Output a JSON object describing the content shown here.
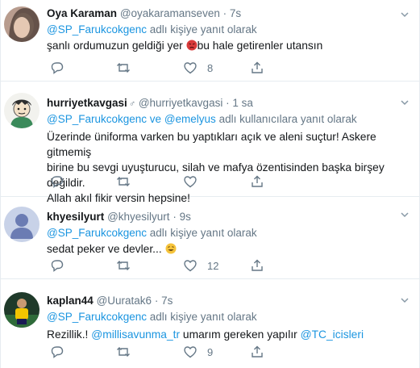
{
  "tweets": [
    {
      "name": "Oya Karaman",
      "handle": "@oyakaramanseven",
      "time": "7s",
      "reply_prefix": "",
      "reply_links": [
        "@SP_Farukcokgenc"
      ],
      "reply_suffix": "adlı kişiye yanıt olarak",
      "text_before": "şanlı ordumuzun geldiği yer",
      "text_after": "bu hale getirenler utansın",
      "reply_count": "",
      "retweet_count": "",
      "like_count": "8"
    },
    {
      "name": "hurriyetkavgasi",
      "name_badge": "♂",
      "handle": "@hurriyetkavgasi",
      "time": "1 sa",
      "reply_links": [
        "@SP_Farukcokgenc",
        "@emelyus"
      ],
      "reply_join": "ve",
      "reply_suffix": "adlı kullanıcılara yanıt olarak",
      "text_lines": [
        "Üzerinde üniforma varken bu yaptıkları açık ve aleni suçtur! Askere gitmemiş",
        "birine bu sevgi uyuşturucu, silah ve mafya özentisinden başka birşey değildir.",
        "Allah akıl fikir versin hepsine!"
      ],
      "reply_count": "",
      "retweet_count": "",
      "like_count": ""
    },
    {
      "name": "khyesilyurt",
      "handle": "@khyesilyurt",
      "time": "9s",
      "reply_links": [
        "@SP_Farukcokgenc"
      ],
      "reply_suffix": "adlı kişiye yanıt olarak",
      "text": "sedat peker ve devler...",
      "reply_count": "",
      "retweet_count": "",
      "like_count": "12"
    },
    {
      "name": "kaplan44",
      "handle": "@Uuratak6",
      "time": "7s",
      "reply_links": [
        "@SP_Farukcokgenc"
      ],
      "reply_suffix": "adlı kişiye yanıt olarak",
      "text_start": "Rezillik.!",
      "mention1": "@millisavunma_tr",
      "text_mid": "umarım gereken yapılır",
      "mention2": "@TC_icisleri",
      "reply_count": "",
      "retweet_count": "",
      "like_count": "9"
    }
  ],
  "separator": "·",
  "icons": {
    "reply": "reply-icon",
    "retweet": "retweet-icon",
    "like": "heart-icon",
    "share": "share-icon",
    "more": "chevron-down-icon"
  },
  "colors": {
    "link": "#1b95e0",
    "muted": "#657786",
    "text": "#14171a",
    "divider": "#e6ecf0"
  }
}
